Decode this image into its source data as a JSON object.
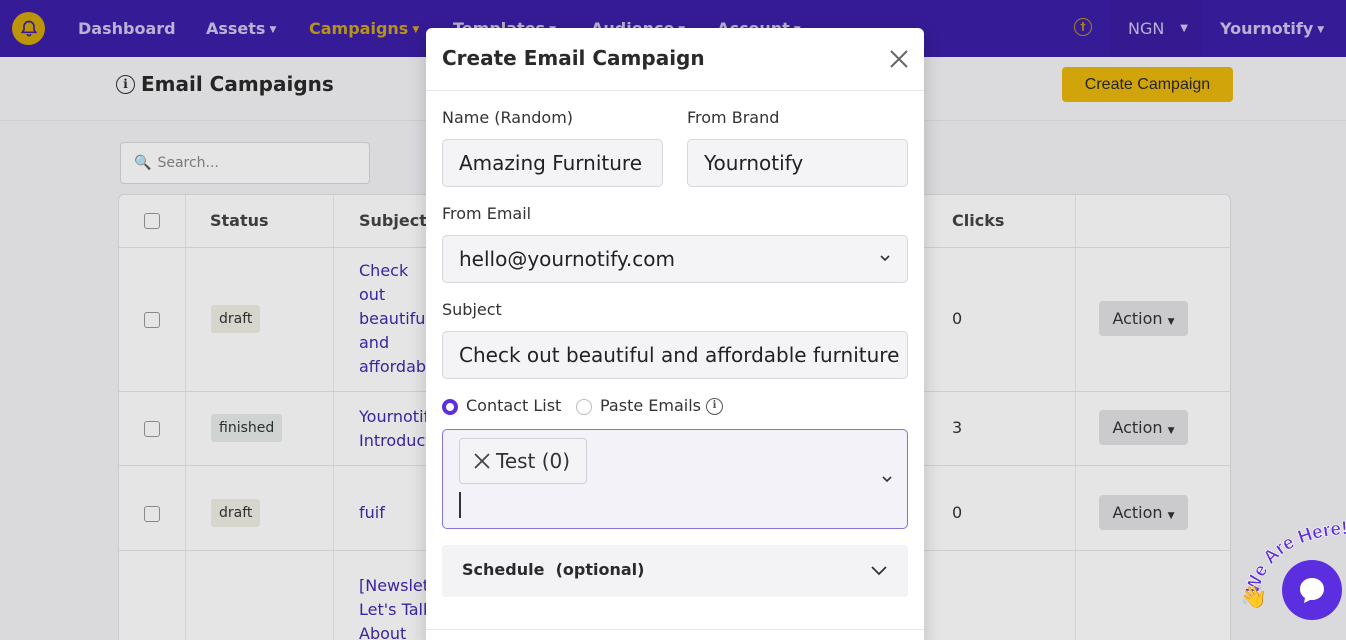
{
  "nav": {
    "items": [
      {
        "label": "Dashboard",
        "caret": false,
        "active": false
      },
      {
        "label": "Assets",
        "caret": true,
        "active": false
      },
      {
        "label": "Campaigns",
        "caret": true,
        "active": true
      },
      {
        "label": "Templates",
        "caret": true,
        "active": false
      },
      {
        "label": "Audience",
        "caret": true,
        "active": false
      },
      {
        "label": "Account",
        "caret": true,
        "active": false
      }
    ],
    "currency": "NGN",
    "user": "Yournotify",
    "accessibility_icon": "accessibility-icon",
    "brand_color": "#3d1fa8",
    "active_color": "#c9a322"
  },
  "page": {
    "title": "Email Campaigns",
    "create_button": "Create Campaign",
    "search_placeholder": "Search..."
  },
  "table": {
    "headers": {
      "status": "Status",
      "subject": "Subject",
      "clicks": "Clicks"
    },
    "rows": [
      {
        "status": "draft",
        "subject": "Check out beautiful and affordable furniture",
        "clicks": "0",
        "action": "Action"
      },
      {
        "status": "finished",
        "subject": "Yournotify Introduction",
        "clicks": "3",
        "action": "Action"
      },
      {
        "status": "draft",
        "subject": "fuif",
        "clicks": "0",
        "action": "Action"
      },
      {
        "status": "",
        "subject": "[Newsletter] Let's Talk About",
        "clicks": "",
        "action": ""
      }
    ]
  },
  "modal": {
    "title": "Create Email Campaign",
    "name_label": "Name (Random)",
    "name_value": "Amazing Furniture",
    "brand_label": "From Brand",
    "brand_value": "Yournotify",
    "email_label": "From Email",
    "email_value": "hello@yournotify.com",
    "subject_label": "Subject",
    "subject_value": "Check out beautiful and affordable furniture",
    "radio_contact": "Contact List",
    "radio_paste": "Paste Emails",
    "selected_list_chip": "Test (0)",
    "schedule_label": "Schedule  (optional)"
  },
  "chat": {
    "bubble_text": "We Are Here!",
    "accent": "#5b2ee0"
  }
}
